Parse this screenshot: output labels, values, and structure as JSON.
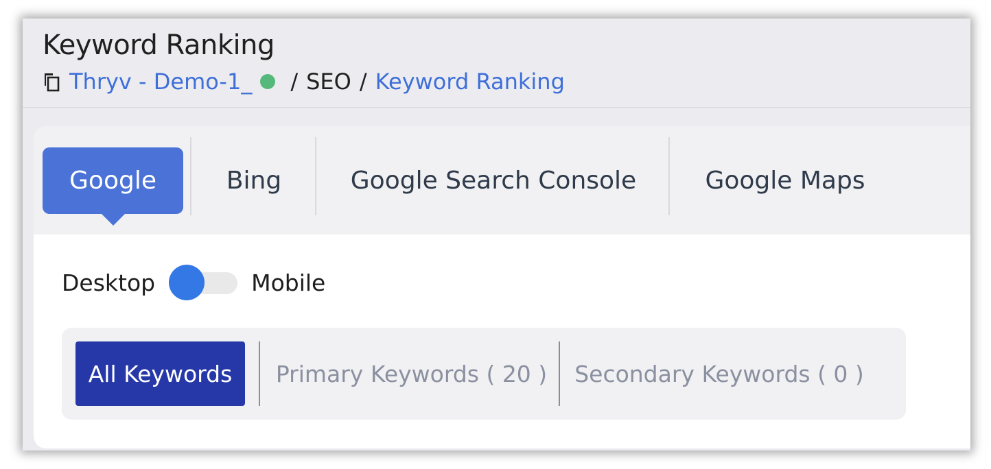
{
  "header": {
    "title": "Keyword Ranking",
    "breadcrumb": {
      "icon": "copy-icon",
      "account": "Thryv - Demo-1_",
      "status_color": "#54b97b",
      "separator": "/",
      "section": "SEO",
      "current": "Keyword Ranking"
    }
  },
  "engine_tabs": [
    {
      "label": "Google",
      "active": true
    },
    {
      "label": "Bing",
      "active": false
    },
    {
      "label": "Google Search Console",
      "active": false
    },
    {
      "label": "Google Maps",
      "active": false
    }
  ],
  "device_toggle": {
    "left_label": "Desktop",
    "right_label": "Mobile",
    "selected": "Desktop"
  },
  "keyword_filters": [
    {
      "label": "All Keywords",
      "active": true
    },
    {
      "label": "Primary Keywords ( 20 )",
      "active": false
    },
    {
      "label": "Secondary Keywords ( 0 )",
      "active": false
    }
  ],
  "colors": {
    "accent": "#4a72d7",
    "filter_active": "#2638a8",
    "link": "#3e6fd8",
    "toggle_knob": "#3478e5"
  }
}
